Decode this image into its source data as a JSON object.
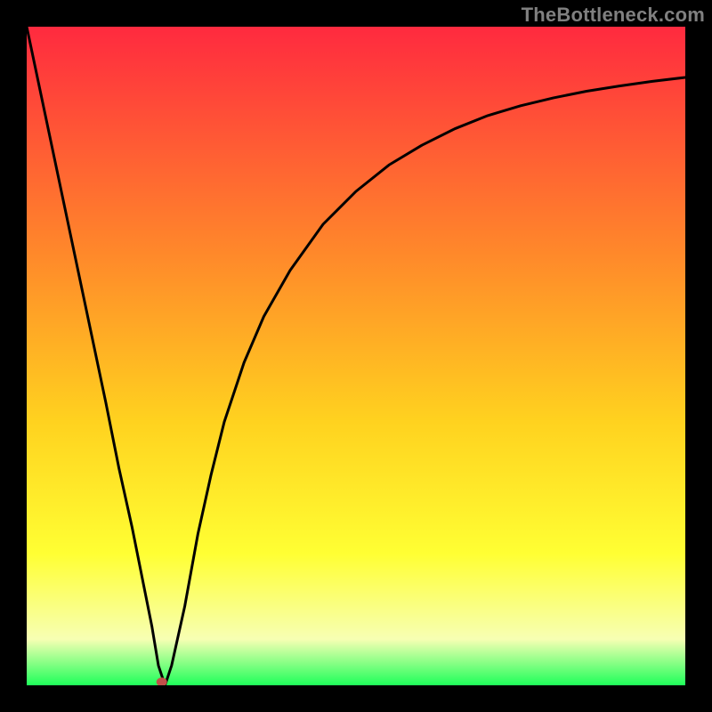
{
  "watermark": "TheBottleneck.com",
  "chart_data": {
    "type": "line",
    "title": "",
    "xlabel": "",
    "ylabel": "",
    "xlim": [
      0,
      100
    ],
    "ylim": [
      0,
      100
    ],
    "grid": false,
    "legend": false,
    "background_gradient": {
      "top": "#ff2a3f",
      "upper_mid": "#ff8a2a",
      "mid": "#ffd21f",
      "lower_mid": "#ffff33",
      "bottom_band": "#f7ffb3",
      "bottom": "#1fff5a"
    },
    "series": [
      {
        "name": "bottleneck-curve",
        "color": "#000000",
        "x": [
          0,
          4,
          8,
          12,
          14,
          16,
          18,
          19,
          20,
          21,
          22,
          24,
          26,
          28,
          30,
          33,
          36,
          40,
          45,
          50,
          55,
          60,
          65,
          70,
          75,
          80,
          85,
          90,
          95,
          100
        ],
        "y": [
          100,
          81,
          62,
          43,
          33,
          24,
          14,
          9,
          3,
          0,
          3,
          12,
          23,
          32,
          40,
          49,
          56,
          63,
          70,
          75,
          79,
          82,
          84.5,
          86.5,
          88,
          89.2,
          90.2,
          91,
          91.7,
          92.3
        ]
      }
    ],
    "marker": {
      "name": "optimal-point",
      "x": 20.5,
      "y": 0.5,
      "color": "#c1504a",
      "rx": 6,
      "ry": 5
    }
  }
}
